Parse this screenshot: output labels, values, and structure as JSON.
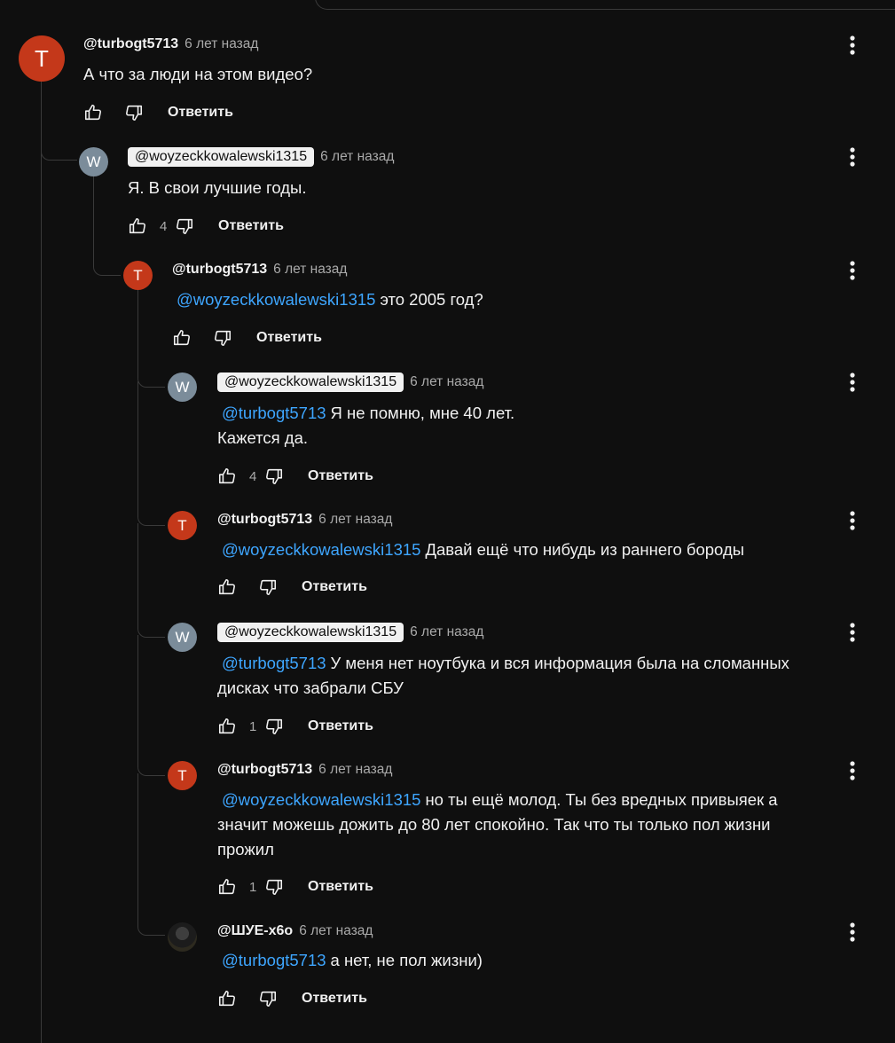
{
  "comments": [
    {
      "author": "@turbogt5713",
      "time": "6 лет назад",
      "avatar": "T",
      "mention": "",
      "text": "А что за люди на этом видео?",
      "likes": "",
      "reply_label": "Ответить"
    },
    {
      "author": "@woyzeckkowalewski1315",
      "time": "6 лет назад",
      "avatar": "W",
      "mention": "",
      "text": "Я. В свои лучшие годы.",
      "likes": "4",
      "reply_label": "Ответить"
    },
    {
      "author": "@turbogt5713",
      "time": "6 лет назад",
      "avatar": "T",
      "mention": "@woyzeckkowalewski1315",
      "text": "это 2005 год?",
      "likes": "",
      "reply_label": "Ответить"
    },
    {
      "author": "@woyzeckkowalewski1315",
      "time": "6 лет назад",
      "avatar": "W",
      "mention": "@turbogt5713",
      "text": "Я не помню, мне 40 лет.",
      "text2": "Кажется да.",
      "likes": "4",
      "reply_label": "Ответить"
    },
    {
      "author": "@turbogt5713",
      "time": "6 лет назад",
      "avatar": "T",
      "mention": "@woyzeckkowalewski1315",
      "text": "Давай ещё что нибудь из раннего бороды",
      "likes": "",
      "reply_label": "Ответить"
    },
    {
      "author": "@woyzeckkowalewski1315",
      "time": "6 лет назад",
      "avatar": "W",
      "mention": "@turbogt5713",
      "text": "У меня нет ноутбука и вся информация была на сломанных",
      "text2": "дисках что забрали СБУ",
      "likes": "1",
      "reply_label": "Ответить"
    },
    {
      "author": "@turbogt5713",
      "time": "6 лет назад",
      "avatar": "T",
      "mention": "@woyzeckkowalewski1315",
      "text": "но ты ещё молод.  Ты без вредных привыяек а",
      "text2": "значит можешь дожить до 80 лет спокойно.  Так что ты только пол жизни",
      "text3": "прожил",
      "likes": "1",
      "reply_label": "Ответить"
    },
    {
      "author": "@ШУЕ-х6о",
      "time": "6 лет назад",
      "avatar": "",
      "mention": "@turbogt5713",
      "text": "а нет, не пол жизни)",
      "likes": "",
      "reply_label": "Ответить"
    }
  ],
  "icons": {
    "like": "thumbs-up-icon",
    "dislike": "thumbs-down-icon",
    "menu": "more-vertical-icon"
  }
}
